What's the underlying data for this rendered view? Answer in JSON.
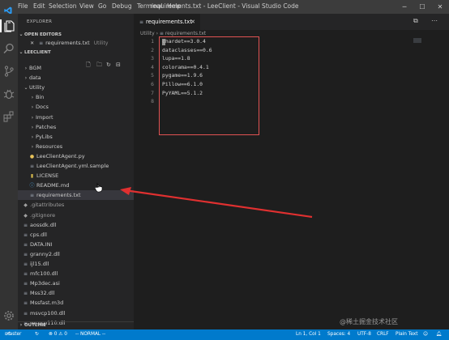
{
  "window": {
    "title": "requirements.txt - LeeClient - Visual Studio Code",
    "menu": [
      "File",
      "Edit",
      "Selection",
      "View",
      "Go",
      "Debug",
      "Terminal",
      "Help"
    ]
  },
  "sidebar": {
    "title": "EXPLORER",
    "open_editors_label": "OPEN EDITORS",
    "open_editor": {
      "name": "requirements.txt",
      "folder": "Utility"
    },
    "folder_label": "LEECLIENT",
    "outline_label": "OUTLINE",
    "tree": [
      {
        "label": "BGM",
        "kind": "folder-closed",
        "depth": 0
      },
      {
        "label": "data",
        "kind": "folder-closed",
        "depth": 0
      },
      {
        "label": "Utility",
        "kind": "folder-open",
        "depth": 0
      },
      {
        "label": "Bin",
        "kind": "folder-closed",
        "depth": 1
      },
      {
        "label": "Docs",
        "kind": "folder-closed",
        "depth": 1
      },
      {
        "label": "Import",
        "kind": "folder-closed",
        "depth": 1
      },
      {
        "label": "Patches",
        "kind": "folder-closed",
        "depth": 1
      },
      {
        "label": "PyLibs",
        "kind": "folder-closed",
        "depth": 1
      },
      {
        "label": "Resources",
        "kind": "folder-closed",
        "depth": 1
      },
      {
        "label": "LeeClientAgent.py",
        "kind": "python",
        "depth": 1
      },
      {
        "label": "LeeClientAgent.yml.sample",
        "kind": "file",
        "depth": 1
      },
      {
        "label": "LICENSE",
        "kind": "license",
        "depth": 1
      },
      {
        "label": "README.md",
        "kind": "info",
        "depth": 1
      },
      {
        "label": "requirements.txt",
        "kind": "text",
        "depth": 1,
        "selected": true
      },
      {
        "label": ".gitattributes",
        "kind": "git",
        "depth": 0
      },
      {
        "label": ".gitignore",
        "kind": "git",
        "depth": 0
      },
      {
        "label": "aossdk.dll",
        "kind": "text",
        "depth": 0
      },
      {
        "label": "cps.dll",
        "kind": "text",
        "depth": 0
      },
      {
        "label": "DATA.INI",
        "kind": "text",
        "depth": 0
      },
      {
        "label": "granny2.dll",
        "kind": "text",
        "depth": 0
      },
      {
        "label": "ijl15.dll",
        "kind": "text",
        "depth": 0
      },
      {
        "label": "mfc100.dll",
        "kind": "text",
        "depth": 0
      },
      {
        "label": "Mp3dec.asi",
        "kind": "text",
        "depth": 0
      },
      {
        "label": "Mss32.dll",
        "kind": "text",
        "depth": 0
      },
      {
        "label": "Mssfast.m3d",
        "kind": "text",
        "depth": 0
      },
      {
        "label": "msvcp100.dll",
        "kind": "text",
        "depth": 0
      },
      {
        "label": "msvcp110.dll",
        "kind": "text",
        "depth": 0
      }
    ]
  },
  "editor": {
    "tab_label": "requirements.txt",
    "breadcrumb": [
      "Utility",
      "requirements.txt"
    ],
    "line_numbers": [
      "1",
      "2",
      "3",
      "4",
      "5",
      "6",
      "7",
      "8"
    ],
    "lines": [
      "chardet==3.0.4",
      "dataclasses==0.6",
      "lupa==1.8",
      "colorama==0.4.1",
      "pygame==1.9.6",
      "Pillow==6.1.0",
      "PyYAML==5.1.2",
      ""
    ]
  },
  "status": {
    "branch": "master",
    "problems": "⊗ 0 ⚠ 0",
    "mode": "-- NORMAL --",
    "position": "Ln 1, Col 1",
    "spaces": "Spaces: 4",
    "encoding": "UTF-8",
    "eol": "CRLF",
    "language": "Plain Text"
  },
  "watermark": "@稀土掘金技术社区",
  "colors": {
    "accent": "#007acc",
    "annotation": "#e05353"
  }
}
